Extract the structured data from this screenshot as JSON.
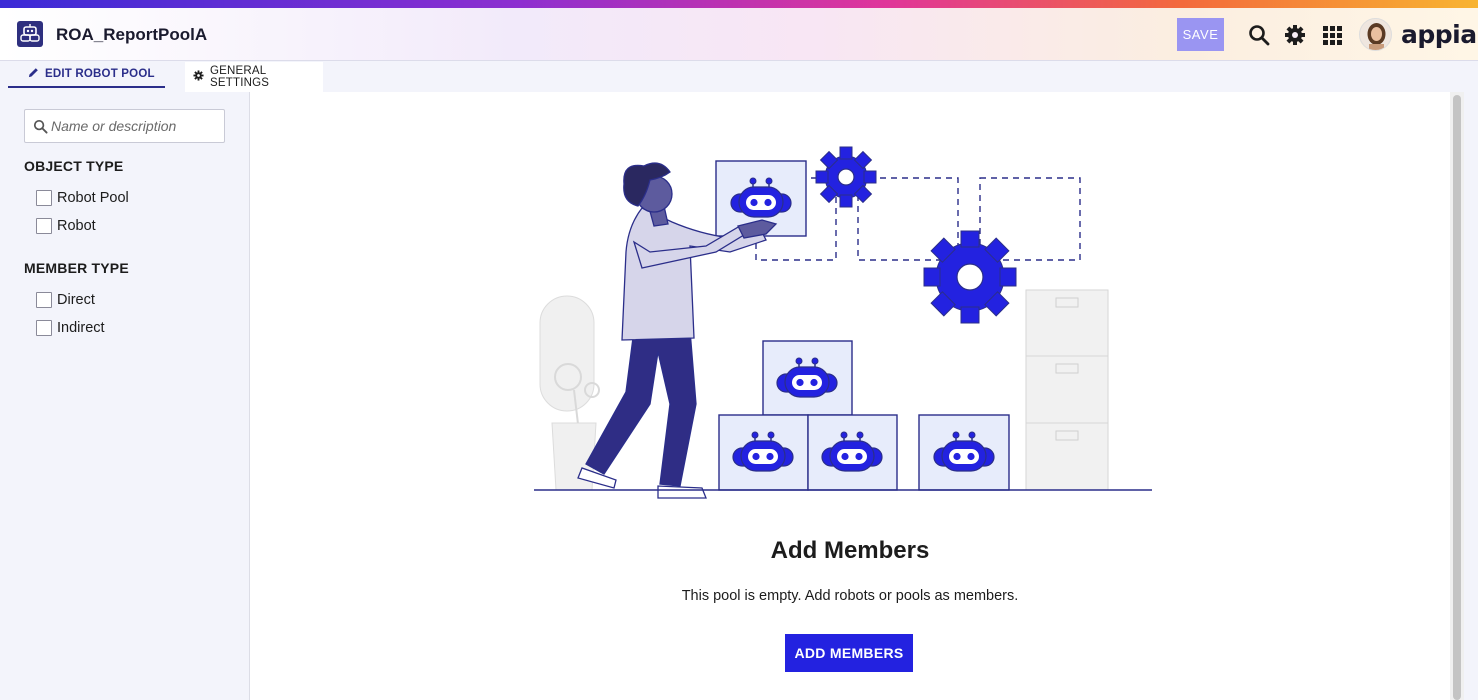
{
  "header": {
    "app_title": "ROA_ReportPoolA",
    "save_label": "SAVE",
    "brand": "appian",
    "icons": [
      "robot-pool-icon",
      "search-icon",
      "gear-icon",
      "app-grid-icon"
    ],
    "save_color": "#9a95f2"
  },
  "tabs": [
    {
      "label": "EDIT ROBOT POOL",
      "icon": "pencil-icon",
      "active": true
    },
    {
      "label": "GENERAL SETTINGS",
      "icon": "gear-icon",
      "active": false
    }
  ],
  "sidebar": {
    "search_placeholder": "Name or description",
    "search_value": "",
    "object_type": {
      "label": "OBJECT TYPE",
      "options": [
        {
          "label": "Robot Pool",
          "checked": false
        },
        {
          "label": "Robot",
          "checked": false
        }
      ]
    },
    "member_type": {
      "label": "MEMBER TYPE",
      "options": [
        {
          "label": "Direct",
          "checked": false
        },
        {
          "label": "Indirect",
          "checked": false
        }
      ]
    }
  },
  "main": {
    "empty_title": "Add Members",
    "empty_text": "This pool is empty. Add robots or pools as members.",
    "add_button": "ADD MEMBERS",
    "accent_color": "#2322e0"
  }
}
